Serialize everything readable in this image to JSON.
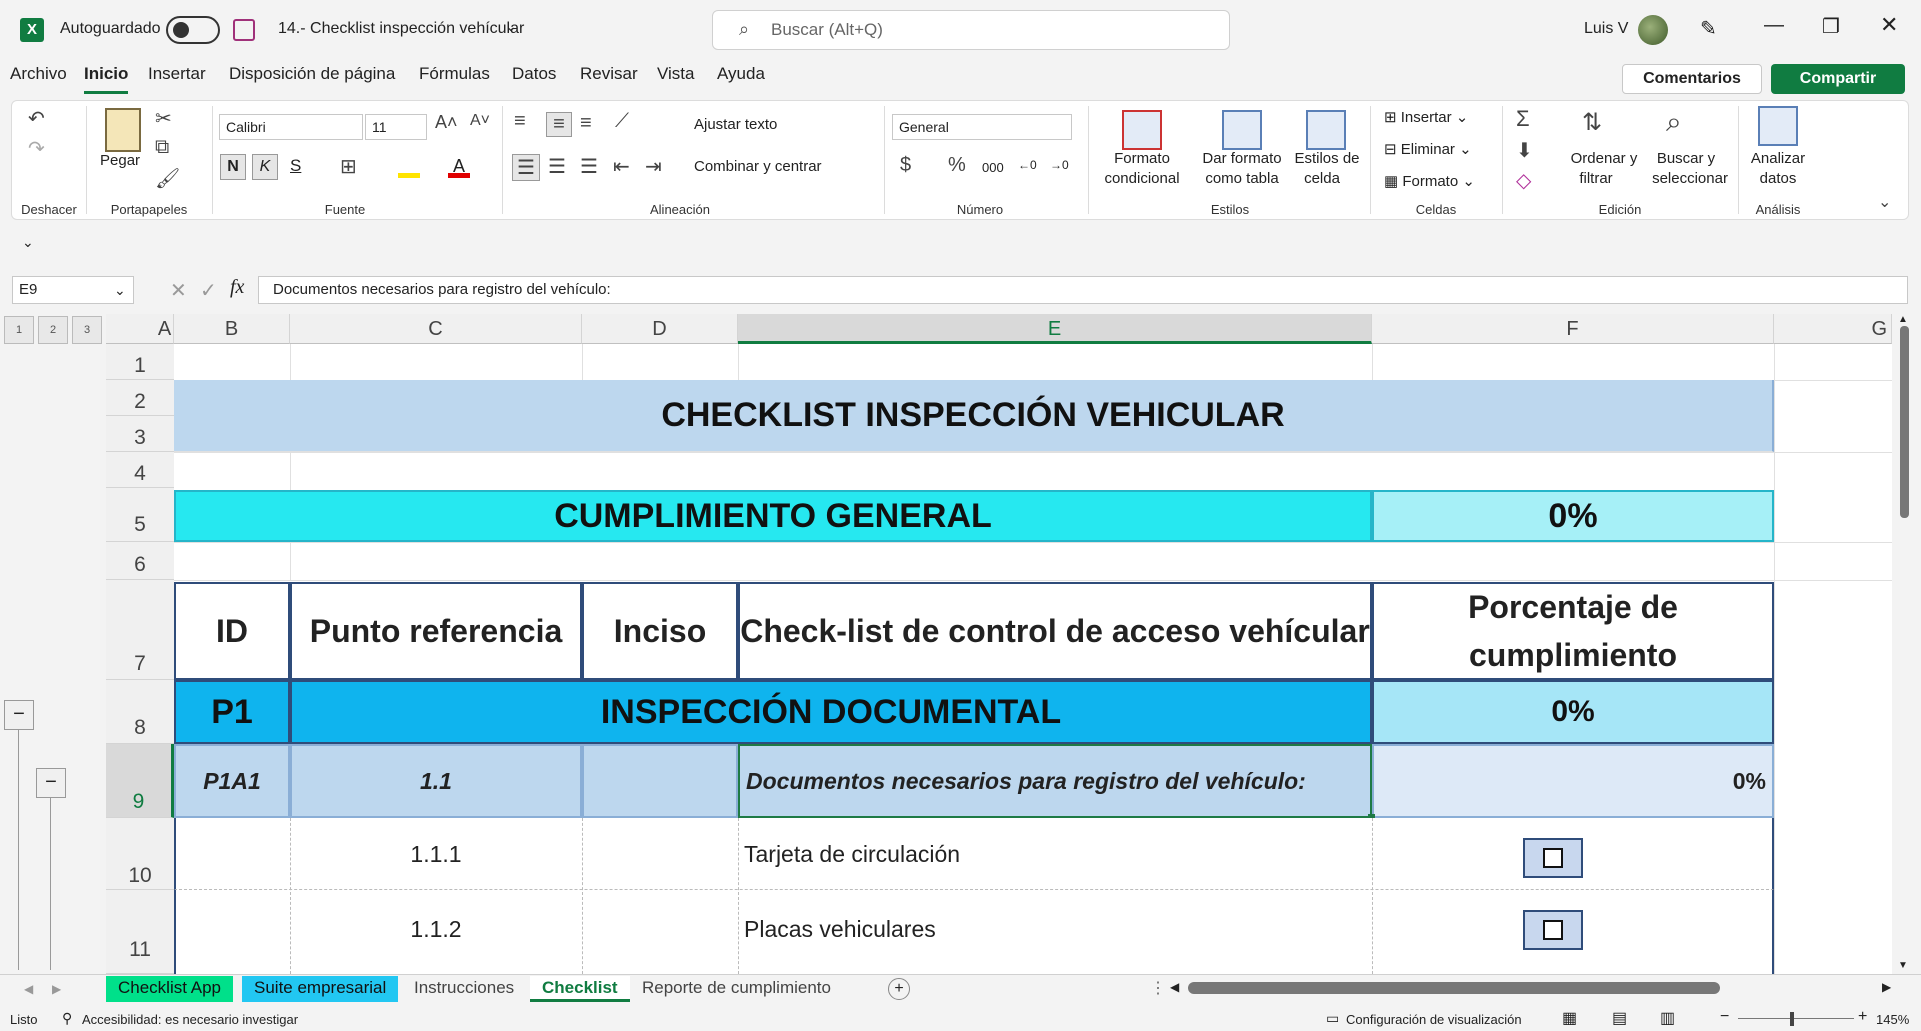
{
  "titlebar": {
    "autosave_label": "Autoguardado",
    "doc_title": "14.- Checklist inspección vehícular",
    "search_placeholder": "Buscar (Alt+Q)",
    "user_name": "Luis V"
  },
  "menu": {
    "items": [
      "Archivo",
      "Inicio",
      "Insertar",
      "Disposición de página",
      "Fórmulas",
      "Datos",
      "Revisar",
      "Vista",
      "Ayuda"
    ],
    "comments_label": "Comentarios",
    "share_label": "Compartir"
  },
  "ribbon": {
    "groups": {
      "undo": "Deshacer",
      "clipboard": "Portapapeles",
      "font": "Fuente",
      "alignment": "Alineación",
      "number": "Número",
      "styles": "Estilos",
      "cells": "Celdas",
      "editing": "Edición",
      "analysis": "Análisis"
    },
    "paste_label": "Pegar",
    "font_name": "Calibri",
    "font_size": "11",
    "wrap_text": "Ajustar texto",
    "merge_center": "Combinar y centrar",
    "number_format": "General",
    "conditional_format_1": "Formato",
    "conditional_format_2": "condicional",
    "format_table_1": "Dar formato",
    "format_table_2": "como tabla",
    "cell_styles_1": "Estilos de",
    "cell_styles_2": "celda",
    "insert": "Insertar",
    "delete": "Eliminar",
    "format": "Formato",
    "sort_1": "Ordenar y",
    "sort_2": "filtrar",
    "find_1": "Buscar y",
    "find_2": "seleccionar",
    "analyze_1": "Analizar",
    "analyze_2": "datos",
    "bold": "N",
    "italic": "K",
    "underline": "S"
  },
  "formula_bar": {
    "name_box": "E9",
    "content": "Documentos necesarios para registro del vehículo:"
  },
  "outline_levels": [
    "1",
    "2",
    "3"
  ],
  "columns": [
    "A",
    "B",
    "C",
    "D",
    "E",
    "F",
    "G"
  ],
  "rows": [
    "1",
    "2",
    "3",
    "4",
    "5",
    "6",
    "7",
    "8",
    "9",
    "10",
    "11"
  ],
  "sheet": {
    "title": "CHECKLIST INSPECCIÓN VEHICULAR",
    "general_label": "CUMPLIMIENTO GENERAL",
    "general_value": "0%",
    "headers": {
      "id": "ID",
      "ref": "Punto referencia",
      "inciso": "Inciso",
      "checklist": "Check-list de control de acceso vehícular",
      "pct_1": "Porcentaje de",
      "pct_2": "cumplimiento"
    },
    "section": {
      "id": "P1",
      "label": "INSPECCIÓN DOCUMENTAL",
      "value": "0%"
    },
    "subsection": {
      "id": "P1A1",
      "ref": "1.1",
      "label": "Documentos necesarios para registro del vehículo:",
      "value": "0%"
    },
    "items": [
      {
        "ref": "1.1.1",
        "label": "Tarjeta de circulación"
      },
      {
        "ref": "1.1.2",
        "label": "Placas vehiculares"
      }
    ]
  },
  "tabs": [
    "Checklist App",
    "Suite empresarial",
    "Instrucciones",
    "Checklist",
    "Reporte de cumplimiento"
  ],
  "status": {
    "ready": "Listo",
    "accessibility": "Accesibilidad: es necesario investigar",
    "display_settings": "Configuración de visualización",
    "zoom": "145%"
  },
  "colors": {
    "title_fill": "#bdd7ee",
    "general_fill": "#26e8f0",
    "general_value_fill": "#a6f0f7",
    "section_fill": "#0fb4ee",
    "section_value_fill": "#a6e6f7",
    "subsection_fill": "#bdd7ee",
    "accent": "#107c41",
    "checklist_tab": "#00e08a",
    "suite_tab": "#22c7f2"
  }
}
